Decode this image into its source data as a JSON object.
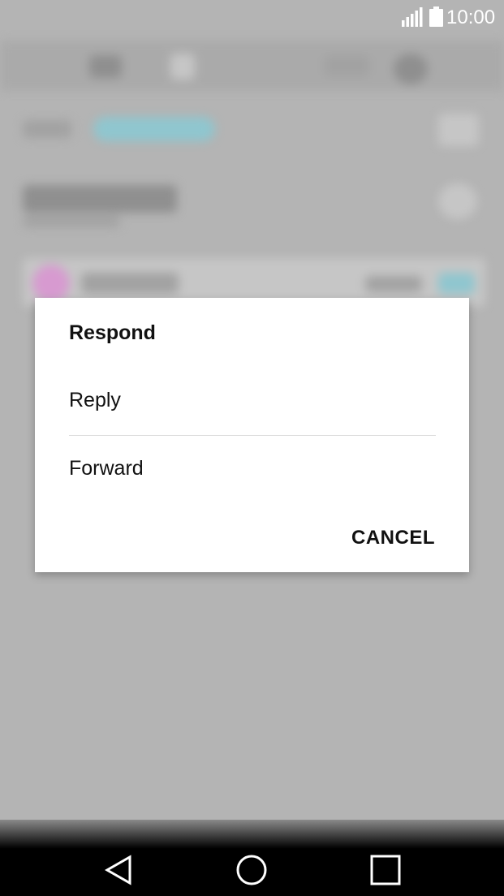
{
  "status_bar": {
    "time": "10:00",
    "icons": [
      "signal-icon",
      "battery-icon"
    ]
  },
  "dialog": {
    "title": "Respond",
    "options": [
      {
        "label": "Reply"
      },
      {
        "label": "Forward"
      }
    ],
    "cancel_label": "CANCEL"
  },
  "nav_bar": {
    "icons": [
      "back-icon",
      "home-icon",
      "recent-apps-icon"
    ]
  },
  "colors": {
    "scrim": "#b4b4b4",
    "dialog_bg": "#ffffff",
    "text": "#111111",
    "nav_bg": "#000000"
  }
}
